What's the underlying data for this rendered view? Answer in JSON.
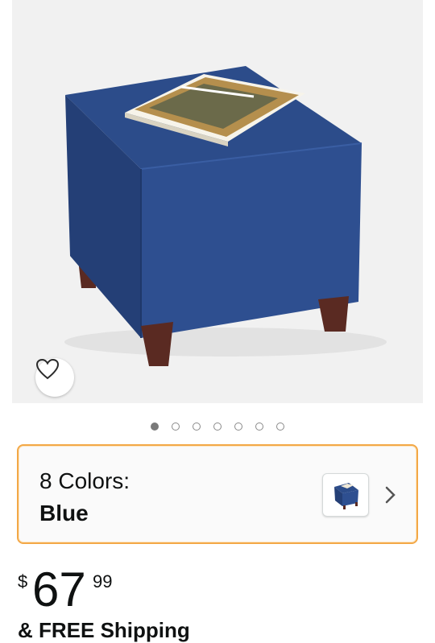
{
  "product": {
    "image_alt": "blue square ottoman",
    "image_count": 7,
    "active_image": 0
  },
  "variant": {
    "label": "8 Colors:",
    "value": "Blue"
  },
  "price": {
    "currency": "$",
    "whole": "67",
    "fraction": "99"
  },
  "shipping": {
    "text": "& FREE Shipping"
  },
  "icons": {
    "favorite": "heart-icon",
    "variant_open": "chevron-right-icon"
  },
  "colors": {
    "accent_border": "#f3a847",
    "ottoman_blue": "#2b4a86",
    "leg_wood": "#5a2a22"
  }
}
